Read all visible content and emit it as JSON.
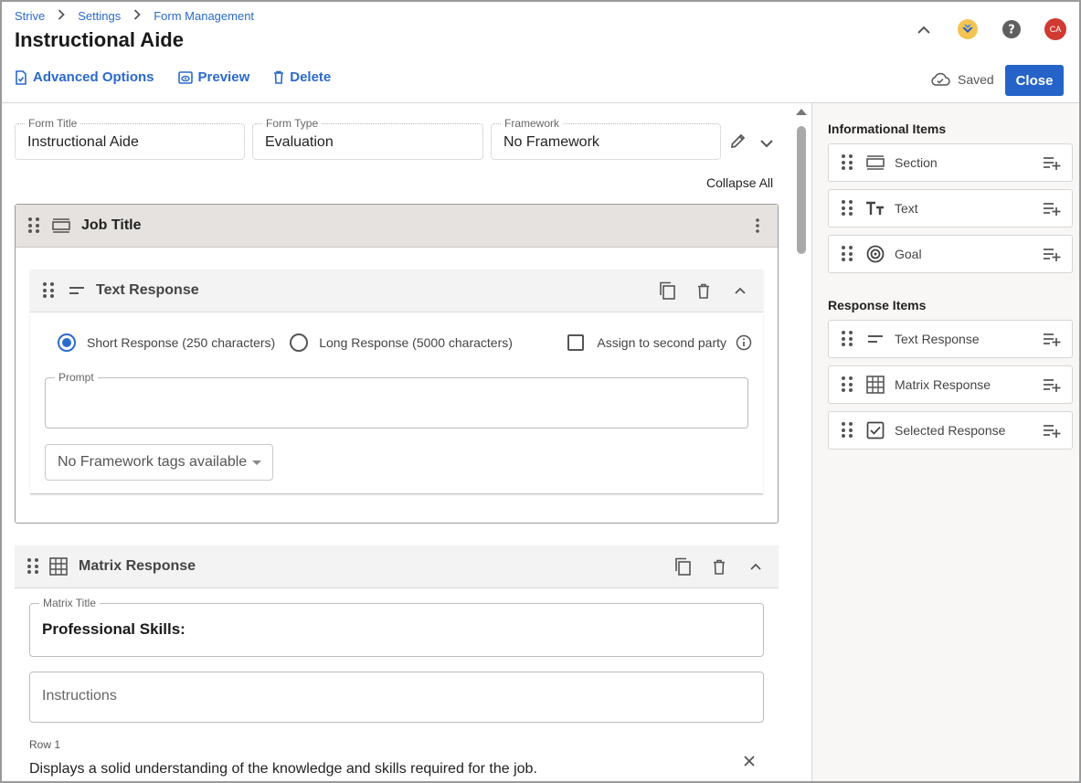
{
  "breadcrumb": [
    "Strive",
    "Settings",
    "Form Management"
  ],
  "page_title": "Instructional Aide",
  "header": {
    "avatar_initials": "CA"
  },
  "toolbar": {
    "advanced_options": "Advanced Options",
    "preview": "Preview",
    "delete": "Delete",
    "saved": "Saved",
    "close": "Close"
  },
  "fields": {
    "form_title_label": "Form Title",
    "form_title_value": "Instructional Aide",
    "form_type_label": "Form Type",
    "form_type_value": "Evaluation",
    "framework_label": "Framework",
    "framework_value": "No Framework"
  },
  "collapse_all": "Collapse All",
  "section": {
    "title": "Job Title"
  },
  "text_response": {
    "title": "Text Response",
    "short_option": "Short Response (250 characters)",
    "long_option": "Long Response (5000 characters)",
    "assign_second_party": "Assign to second party",
    "prompt_label": "Prompt",
    "tags_select": "No Framework tags available"
  },
  "matrix_response": {
    "title": "Matrix Response",
    "matrix_title_label": "Matrix Title",
    "matrix_title_value": "Professional Skills:",
    "instructions_placeholder": "Instructions",
    "row1_label": "Row 1",
    "row1_value": "Displays a solid understanding of the knowledge and skills required for the job."
  },
  "right_panel": {
    "informational_heading": "Informational Items",
    "informational_items": [
      "Section",
      "Text",
      "Goal"
    ],
    "response_heading": "Response Items",
    "response_items": [
      "Text Response",
      "Matrix Response",
      "Selected Response"
    ]
  },
  "colors": {
    "accent": "#2563c9",
    "link": "#2a6acb",
    "avatar": "#d13a32"
  }
}
